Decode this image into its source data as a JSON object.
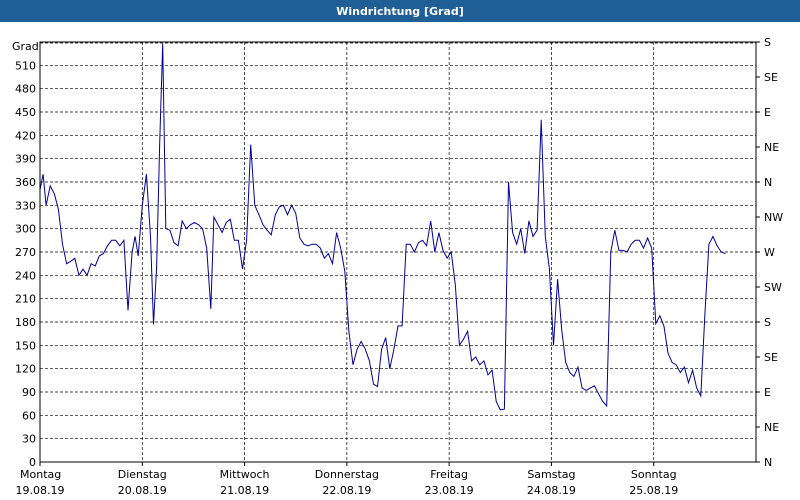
{
  "window": {
    "title": "Windrichtung [Grad]"
  },
  "colors": {
    "titlebar": "#1f5f95",
    "series": "#000099",
    "grid": "#000000",
    "background": "#ffffff"
  },
  "chart_data": {
    "type": "line",
    "title": "Windrichtung [Grad]",
    "ylabel": "Grad",
    "ylim": [
      0,
      540
    ],
    "xlim": [
      0,
      7
    ],
    "grid": true,
    "left_ticks": [
      0,
      30,
      60,
      90,
      120,
      150,
      180,
      210,
      240,
      270,
      300,
      330,
      360,
      390,
      420,
      450,
      480,
      510
    ],
    "right_axis_labels": [
      {
        "value": 0,
        "label": "N"
      },
      {
        "value": 45,
        "label": "NE"
      },
      {
        "value": 90,
        "label": "E"
      },
      {
        "value": 135,
        "label": "SE"
      },
      {
        "value": 180,
        "label": "S"
      },
      {
        "value": 225,
        "label": "SW"
      },
      {
        "value": 270,
        "label": "W"
      },
      {
        "value": 315,
        "label": "NW"
      },
      {
        "value": 360,
        "label": "N"
      },
      {
        "value": 405,
        "label": "NE"
      },
      {
        "value": 450,
        "label": "E"
      },
      {
        "value": 495,
        "label": "SE"
      },
      {
        "value": 540,
        "label": "S"
      }
    ],
    "x_categories": [
      {
        "day": "Montag",
        "date": "19.08.19"
      },
      {
        "day": "Dienstag",
        "date": "20.08.19"
      },
      {
        "day": "Mittwoch",
        "date": "21.08.19"
      },
      {
        "day": "Donnerstag",
        "date": "22.08.19"
      },
      {
        "day": "Freitag",
        "date": "23.08.19"
      },
      {
        "day": "Samstag",
        "date": "24.08.19"
      },
      {
        "day": "Sonntag",
        "date": "25.08.19"
      }
    ],
    "series": [
      {
        "points": [
          [
            0.0,
            350
          ],
          [
            0.03,
            370
          ],
          [
            0.06,
            330
          ],
          [
            0.1,
            355
          ],
          [
            0.14,
            345
          ],
          [
            0.18,
            325
          ],
          [
            0.22,
            280
          ],
          [
            0.26,
            255
          ],
          [
            0.3,
            258
          ],
          [
            0.34,
            262
          ],
          [
            0.38,
            240
          ],
          [
            0.42,
            248
          ],
          [
            0.46,
            240
          ],
          [
            0.5,
            255
          ],
          [
            0.54,
            252
          ],
          [
            0.58,
            265
          ],
          [
            0.62,
            268
          ],
          [
            0.66,
            278
          ],
          [
            0.7,
            285
          ],
          [
            0.74,
            285
          ],
          [
            0.78,
            278
          ],
          [
            0.82,
            285
          ],
          [
            0.86,
            195
          ],
          [
            0.9,
            270
          ],
          [
            0.93,
            290
          ],
          [
            0.96,
            265
          ],
          [
            1.0,
            330
          ],
          [
            1.04,
            370
          ],
          [
            1.08,
            290
          ],
          [
            1.11,
            177
          ],
          [
            1.14,
            250
          ],
          [
            1.17,
            410
          ],
          [
            1.2,
            538
          ],
          [
            1.23,
            300
          ],
          [
            1.27,
            298
          ],
          [
            1.31,
            282
          ],
          [
            1.35,
            278
          ],
          [
            1.39,
            310
          ],
          [
            1.43,
            300
          ],
          [
            1.47,
            305
          ],
          [
            1.51,
            308
          ],
          [
            1.55,
            305
          ],
          [
            1.59,
            300
          ],
          [
            1.63,
            275
          ],
          [
            1.67,
            197
          ],
          [
            1.7,
            315
          ],
          [
            1.74,
            305
          ],
          [
            1.78,
            295
          ],
          [
            1.82,
            308
          ],
          [
            1.86,
            312
          ],
          [
            1.9,
            285
          ],
          [
            1.94,
            285
          ],
          [
            1.98,
            248
          ],
          [
            2.02,
            285
          ],
          [
            2.06,
            408
          ],
          [
            2.1,
            330
          ],
          [
            2.14,
            318
          ],
          [
            2.18,
            305
          ],
          [
            2.22,
            298
          ],
          [
            2.26,
            292
          ],
          [
            2.3,
            318
          ],
          [
            2.34,
            328
          ],
          [
            2.38,
            330
          ],
          [
            2.42,
            318
          ],
          [
            2.46,
            330
          ],
          [
            2.5,
            320
          ],
          [
            2.54,
            288
          ],
          [
            2.58,
            280
          ],
          [
            2.62,
            278
          ],
          [
            2.66,
            280
          ],
          [
            2.7,
            280
          ],
          [
            2.74,
            275
          ],
          [
            2.78,
            262
          ],
          [
            2.82,
            268
          ],
          [
            2.86,
            255
          ],
          [
            2.9,
            295
          ],
          [
            2.94,
            275
          ],
          [
            2.98,
            245
          ],
          [
            3.02,
            168
          ],
          [
            3.06,
            125
          ],
          [
            3.1,
            145
          ],
          [
            3.14,
            155
          ],
          [
            3.18,
            145
          ],
          [
            3.22,
            130
          ],
          [
            3.26,
            100
          ],
          [
            3.3,
            97
          ],
          [
            3.34,
            145
          ],
          [
            3.38,
            160
          ],
          [
            3.42,
            120
          ],
          [
            3.46,
            145
          ],
          [
            3.5,
            175
          ],
          [
            3.54,
            175
          ],
          [
            3.58,
            280
          ],
          [
            3.62,
            280
          ],
          [
            3.66,
            270
          ],
          [
            3.7,
            282
          ],
          [
            3.74,
            285
          ],
          [
            3.78,
            278
          ],
          [
            3.82,
            310
          ],
          [
            3.86,
            270
          ],
          [
            3.9,
            295
          ],
          [
            3.94,
            272
          ],
          [
            3.98,
            262
          ],
          [
            4.02,
            270
          ],
          [
            4.06,
            228
          ],
          [
            4.1,
            150
          ],
          [
            4.14,
            158
          ],
          [
            4.18,
            168
          ],
          [
            4.22,
            130
          ],
          [
            4.26,
            135
          ],
          [
            4.3,
            125
          ],
          [
            4.34,
            130
          ],
          [
            4.38,
            112
          ],
          [
            4.42,
            118
          ],
          [
            4.46,
            78
          ],
          [
            4.5,
            67
          ],
          [
            4.54,
            68
          ],
          [
            4.58,
            360
          ],
          [
            4.62,
            295
          ],
          [
            4.66,
            280
          ],
          [
            4.7,
            300
          ],
          [
            4.74,
            268
          ],
          [
            4.78,
            310
          ],
          [
            4.82,
            290
          ],
          [
            4.86,
            298
          ],
          [
            4.9,
            440
          ],
          [
            4.94,
            290
          ],
          [
            4.98,
            248
          ],
          [
            5.02,
            150
          ],
          [
            5.06,
            235
          ],
          [
            5.1,
            170
          ],
          [
            5.14,
            128
          ],
          [
            5.18,
            115
          ],
          [
            5.22,
            110
          ],
          [
            5.26,
            122
          ],
          [
            5.3,
            95
          ],
          [
            5.34,
            92
          ],
          [
            5.38,
            95
          ],
          [
            5.42,
            98
          ],
          [
            5.46,
            88
          ],
          [
            5.5,
            78
          ],
          [
            5.54,
            72
          ],
          [
            5.58,
            270
          ],
          [
            5.62,
            298
          ],
          [
            5.66,
            272
          ],
          [
            5.7,
            272
          ],
          [
            5.74,
            270
          ],
          [
            5.78,
            280
          ],
          [
            5.82,
            285
          ],
          [
            5.86,
            285
          ],
          [
            5.9,
            275
          ],
          [
            5.94,
            288
          ],
          [
            5.98,
            275
          ],
          [
            6.02,
            178
          ],
          [
            6.06,
            188
          ],
          [
            6.1,
            175
          ],
          [
            6.14,
            140
          ],
          [
            6.18,
            128
          ],
          [
            6.22,
            125
          ],
          [
            6.26,
            115
          ],
          [
            6.3,
            122
          ],
          [
            6.34,
            102
          ],
          [
            6.38,
            118
          ],
          [
            6.42,
            95
          ],
          [
            6.46,
            85
          ],
          [
            6.5,
            190
          ],
          [
            6.54,
            280
          ],
          [
            6.58,
            290
          ],
          [
            6.62,
            278
          ],
          [
            6.66,
            270
          ],
          [
            6.7,
            268
          ]
        ]
      }
    ]
  }
}
